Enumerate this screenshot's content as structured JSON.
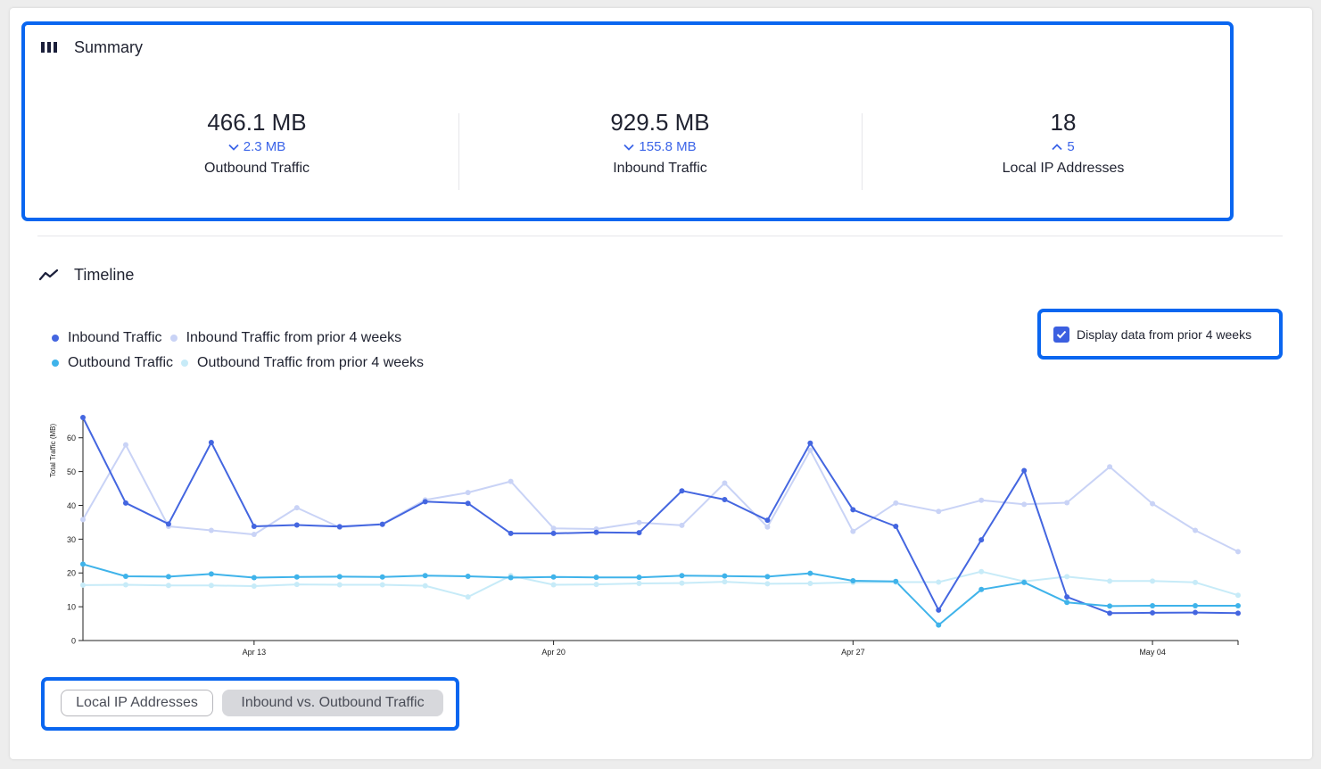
{
  "summary": {
    "title": "Summary",
    "icon": "bar-columns-icon",
    "stats": [
      {
        "value": "466.1 MB",
        "delta": "2.3 MB",
        "direction": "down",
        "label": "Outbound Traffic"
      },
      {
        "value": "929.5 MB",
        "delta": "155.8 MB",
        "direction": "down",
        "label": "Inbound Traffic"
      },
      {
        "value": "18",
        "delta": "5",
        "direction": "up",
        "label": "Local IP Addresses"
      }
    ]
  },
  "timeline": {
    "title": "Timeline",
    "icon": "trend-line-icon",
    "checkbox_label": "Display data from prior 4 weeks",
    "checkbox_checked": true
  },
  "tabs": {
    "local_ip": "Local IP Addresses",
    "inbound_outbound": "Inbound vs. Outbound Traffic",
    "active": "inbound_outbound"
  },
  "chart_data": {
    "type": "line",
    "title": "",
    "xlabel": "",
    "ylabel": "Total Traffic (MB)",
    "ylim": [
      0,
      66
    ],
    "yticks": [
      0,
      10,
      20,
      30,
      40,
      50,
      60
    ],
    "x": [
      "Apr 10",
      "Apr 11",
      "Apr 12",
      "Apr 13",
      "Apr 14",
      "Apr 15",
      "Apr 16",
      "Apr 17",
      "Apr 18",
      "Apr 19",
      "Apr 20",
      "Apr 21",
      "Apr 22",
      "Apr 23",
      "Apr 24",
      "Apr 25",
      "Apr 26",
      "Apr 27",
      "Apr 28",
      "Apr 29",
      "Apr 30",
      "May 01",
      "May 02",
      "May 03",
      "May 04",
      "May 05",
      "May 06",
      "May 07"
    ],
    "xticks": [
      {
        "index": 4,
        "label": "Apr 13"
      },
      {
        "index": 11,
        "label": "Apr 20"
      },
      {
        "index": 18,
        "label": "Apr 27"
      },
      {
        "index": 25,
        "label": "May 04"
      }
    ],
    "legend_position": "top-left",
    "series": [
      {
        "name": "Inbound Traffic",
        "color": "#4466e0",
        "opacity": 1,
        "values": [
          66,
          40.7,
          34.5,
          58.6,
          33.8,
          34.2,
          33.7,
          34.4,
          41.1,
          40.6,
          31.7,
          31.7,
          32.0,
          31.9,
          44.3,
          41.7,
          35.6,
          58.4,
          38.7,
          33.8,
          9.0,
          29.8,
          50.3,
          12.9,
          8.1,
          8.2,
          8.3,
          8.1
        ]
      },
      {
        "name": "Outbound Traffic",
        "color": "#3fb3ea",
        "opacity": 1,
        "values": [
          22.6,
          19.0,
          18.9,
          19.7,
          18.6,
          18.8,
          18.9,
          18.8,
          19.2,
          19.0,
          18.6,
          18.8,
          18.7,
          18.7,
          19.2,
          19.1,
          18.9,
          19.9,
          17.7,
          17.5,
          4.6,
          15.1,
          17.2,
          11.3,
          10.2,
          10.3,
          10.3,
          10.3
        ]
      },
      {
        "name": "Inbound Traffic from prior 4 weeks",
        "color": "#c9d3f6",
        "opacity": 1,
        "values": [
          35.8,
          57.9,
          33.8,
          32.6,
          31.4,
          39.3,
          33.5,
          34.5,
          41.6,
          43.8,
          47.1,
          33.2,
          33.0,
          34.9,
          34.1,
          46.6,
          33.6,
          56.3,
          32.3,
          40.7,
          38.2,
          41.5,
          40.3,
          40.8,
          51.4,
          40.5,
          32.6,
          26.3
        ]
      },
      {
        "name": "Outbound Traffic from prior 4 weeks",
        "color": "#c7ebf8",
        "opacity": 1,
        "values": [
          16.4,
          16.5,
          16.3,
          16.3,
          16.1,
          16.6,
          16.5,
          16.5,
          16.2,
          12.9,
          19.2,
          16.5,
          16.6,
          16.9,
          17.0,
          17.4,
          16.8,
          16.9,
          17.2,
          17.3,
          17.3,
          20.4,
          17.5,
          18.9,
          17.6,
          17.6,
          17.2,
          13.4
        ]
      }
    ]
  }
}
